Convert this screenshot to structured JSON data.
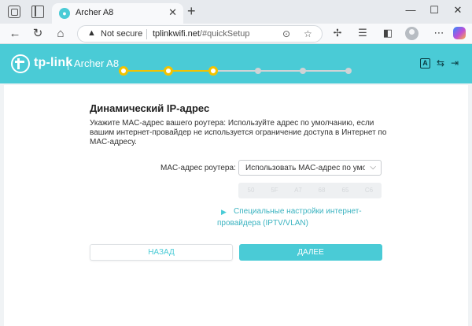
{
  "browser": {
    "tab_title": "Archer A8",
    "tab_close": "✕",
    "new_tab": "+",
    "not_secure": "Not secure",
    "url_host": "tplinkwifi.net",
    "url_path": "/#quickSetup",
    "window_controls": {
      "minimize": "—",
      "maximize": "☐",
      "close": "✕"
    }
  },
  "header": {
    "brand": "tp-link",
    "model": "Archer A8",
    "icons": [
      "language-icon",
      "swap-icon",
      "logout-icon"
    ]
  },
  "stepper": {
    "total_steps": 6,
    "completed_steps": 3
  },
  "content": {
    "title": "Динамический IP-адрес",
    "description": "Укажите MAC-адрес вашего роутера: Используйте адрес по умолчанию, если вашим интернет-провайдер не используется ограничение доступа в Интернет по MAC-адресу.",
    "mac_label": "MAC-адрес роутера:",
    "mac_select_value": "Использовать MAC-адрес по умолчанию",
    "mac_segments": [
      "50",
      "5F",
      "A7",
      "68",
      "65",
      "C6"
    ],
    "advanced_link_line1": "Специальные настройки интернет-",
    "advanced_link_line2": "провайдера (IPTV/VLAN)"
  },
  "buttons": {
    "back": "НАЗАД",
    "next": "ДАЛЕЕ"
  },
  "colors": {
    "accent": "#4acbd6",
    "step_done": "#f2c200",
    "step_todo": "#d0d3d6"
  }
}
